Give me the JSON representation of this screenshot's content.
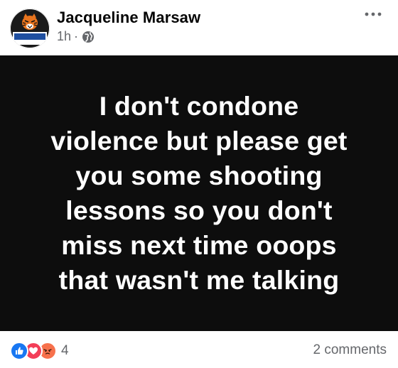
{
  "post": {
    "author": "Jacqueline Marsaw",
    "time": "1h",
    "separator": "·",
    "audience_icon": "globe-icon",
    "more_icon": "more-options-icon",
    "avatar_text": "JACKSON",
    "lines": [
      "I don't condone",
      "violence but please get",
      "you some  shooting",
      "lessons so you don't",
      "miss next time ooops",
      "that wasn't me talking"
    ]
  },
  "footer": {
    "reaction_icons": [
      "like-icon",
      "love-icon",
      "angry-icon"
    ],
    "reaction_count": "4",
    "comments": "2 comments"
  },
  "colors": {
    "post_background": "#0d0d0d",
    "post_text": "#ffffff",
    "meta_text": "#65676b",
    "like": "#1877f2",
    "love": "#f33e58",
    "angry": "#f7714c"
  }
}
